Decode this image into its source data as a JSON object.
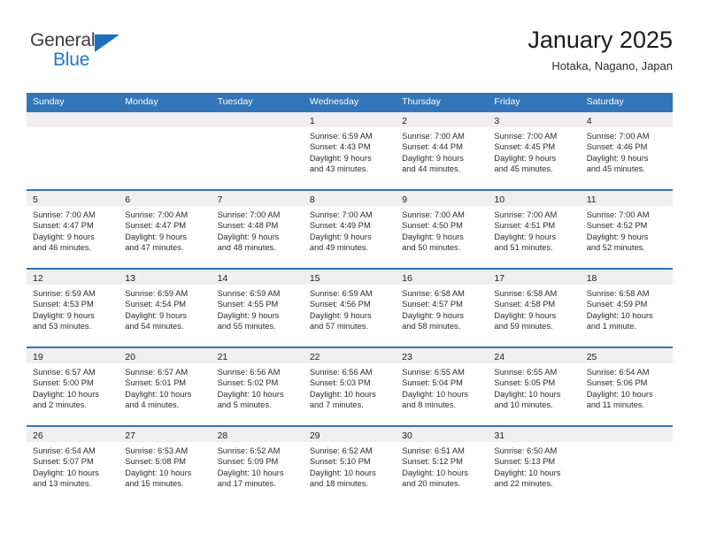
{
  "brand": {
    "name_top": "General",
    "name_bottom": "Blue",
    "accent_color": "#2079c8",
    "triangle_color": "#1f6fc0",
    "top_text_color": "#3c3c3c"
  },
  "header": {
    "title": "January 2025",
    "subtitle": "Hotaka, Nagano, Japan"
  },
  "theme": {
    "header_blue": "#3275b8",
    "band_gray": "#efefef",
    "text": "#222222"
  },
  "weekdays": [
    "Sunday",
    "Monday",
    "Tuesday",
    "Wednesday",
    "Thursday",
    "Friday",
    "Saturday"
  ],
  "weeks": [
    [
      {
        "day": "",
        "empty": true
      },
      {
        "day": "",
        "empty": true
      },
      {
        "day": "",
        "empty": true
      },
      {
        "day": "1",
        "sunrise": "Sunrise: 6:59 AM",
        "sunset": "Sunset: 4:43 PM",
        "daylight_1": "Daylight: 9 hours",
        "daylight_2": "and 43 minutes."
      },
      {
        "day": "2",
        "sunrise": "Sunrise: 7:00 AM",
        "sunset": "Sunset: 4:44 PM",
        "daylight_1": "Daylight: 9 hours",
        "daylight_2": "and 44 minutes."
      },
      {
        "day": "3",
        "sunrise": "Sunrise: 7:00 AM",
        "sunset": "Sunset: 4:45 PM",
        "daylight_1": "Daylight: 9 hours",
        "daylight_2": "and 45 minutes."
      },
      {
        "day": "4",
        "sunrise": "Sunrise: 7:00 AM",
        "sunset": "Sunset: 4:46 PM",
        "daylight_1": "Daylight: 9 hours",
        "daylight_2": "and 45 minutes."
      }
    ],
    [
      {
        "day": "5",
        "sunrise": "Sunrise: 7:00 AM",
        "sunset": "Sunset: 4:47 PM",
        "daylight_1": "Daylight: 9 hours",
        "daylight_2": "and 46 minutes."
      },
      {
        "day": "6",
        "sunrise": "Sunrise: 7:00 AM",
        "sunset": "Sunset: 4:47 PM",
        "daylight_1": "Daylight: 9 hours",
        "daylight_2": "and 47 minutes."
      },
      {
        "day": "7",
        "sunrise": "Sunrise: 7:00 AM",
        "sunset": "Sunset: 4:48 PM",
        "daylight_1": "Daylight: 9 hours",
        "daylight_2": "and 48 minutes."
      },
      {
        "day": "8",
        "sunrise": "Sunrise: 7:00 AM",
        "sunset": "Sunset: 4:49 PM",
        "daylight_1": "Daylight: 9 hours",
        "daylight_2": "and 49 minutes."
      },
      {
        "day": "9",
        "sunrise": "Sunrise: 7:00 AM",
        "sunset": "Sunset: 4:50 PM",
        "daylight_1": "Daylight: 9 hours",
        "daylight_2": "and 50 minutes."
      },
      {
        "day": "10",
        "sunrise": "Sunrise: 7:00 AM",
        "sunset": "Sunset: 4:51 PM",
        "daylight_1": "Daylight: 9 hours",
        "daylight_2": "and 51 minutes."
      },
      {
        "day": "11",
        "sunrise": "Sunrise: 7:00 AM",
        "sunset": "Sunset: 4:52 PM",
        "daylight_1": "Daylight: 9 hours",
        "daylight_2": "and 52 minutes."
      }
    ],
    [
      {
        "day": "12",
        "sunrise": "Sunrise: 6:59 AM",
        "sunset": "Sunset: 4:53 PM",
        "daylight_1": "Daylight: 9 hours",
        "daylight_2": "and 53 minutes."
      },
      {
        "day": "13",
        "sunrise": "Sunrise: 6:59 AM",
        "sunset": "Sunset: 4:54 PM",
        "daylight_1": "Daylight: 9 hours",
        "daylight_2": "and 54 minutes."
      },
      {
        "day": "14",
        "sunrise": "Sunrise: 6:59 AM",
        "sunset": "Sunset: 4:55 PM",
        "daylight_1": "Daylight: 9 hours",
        "daylight_2": "and 55 minutes."
      },
      {
        "day": "15",
        "sunrise": "Sunrise: 6:59 AM",
        "sunset": "Sunset: 4:56 PM",
        "daylight_1": "Daylight: 9 hours",
        "daylight_2": "and 57 minutes."
      },
      {
        "day": "16",
        "sunrise": "Sunrise: 6:58 AM",
        "sunset": "Sunset: 4:57 PM",
        "daylight_1": "Daylight: 9 hours",
        "daylight_2": "and 58 minutes."
      },
      {
        "day": "17",
        "sunrise": "Sunrise: 6:58 AM",
        "sunset": "Sunset: 4:58 PM",
        "daylight_1": "Daylight: 9 hours",
        "daylight_2": "and 59 minutes."
      },
      {
        "day": "18",
        "sunrise": "Sunrise: 6:58 AM",
        "sunset": "Sunset: 4:59 PM",
        "daylight_1": "Daylight: 10 hours",
        "daylight_2": "and 1 minute."
      }
    ],
    [
      {
        "day": "19",
        "sunrise": "Sunrise: 6:57 AM",
        "sunset": "Sunset: 5:00 PM",
        "daylight_1": "Daylight: 10 hours",
        "daylight_2": "and 2 minutes."
      },
      {
        "day": "20",
        "sunrise": "Sunrise: 6:57 AM",
        "sunset": "Sunset: 5:01 PM",
        "daylight_1": "Daylight: 10 hours",
        "daylight_2": "and 4 minutes."
      },
      {
        "day": "21",
        "sunrise": "Sunrise: 6:56 AM",
        "sunset": "Sunset: 5:02 PM",
        "daylight_1": "Daylight: 10 hours",
        "daylight_2": "and 5 minutes."
      },
      {
        "day": "22",
        "sunrise": "Sunrise: 6:56 AM",
        "sunset": "Sunset: 5:03 PM",
        "daylight_1": "Daylight: 10 hours",
        "daylight_2": "and 7 minutes."
      },
      {
        "day": "23",
        "sunrise": "Sunrise: 6:55 AM",
        "sunset": "Sunset: 5:04 PM",
        "daylight_1": "Daylight: 10 hours",
        "daylight_2": "and 8 minutes."
      },
      {
        "day": "24",
        "sunrise": "Sunrise: 6:55 AM",
        "sunset": "Sunset: 5:05 PM",
        "daylight_1": "Daylight: 10 hours",
        "daylight_2": "and 10 minutes."
      },
      {
        "day": "25",
        "sunrise": "Sunrise: 6:54 AM",
        "sunset": "Sunset: 5:06 PM",
        "daylight_1": "Daylight: 10 hours",
        "daylight_2": "and 11 minutes."
      }
    ],
    [
      {
        "day": "26",
        "sunrise": "Sunrise: 6:54 AM",
        "sunset": "Sunset: 5:07 PM",
        "daylight_1": "Daylight: 10 hours",
        "daylight_2": "and 13 minutes."
      },
      {
        "day": "27",
        "sunrise": "Sunrise: 6:53 AM",
        "sunset": "Sunset: 5:08 PM",
        "daylight_1": "Daylight: 10 hours",
        "daylight_2": "and 15 minutes."
      },
      {
        "day": "28",
        "sunrise": "Sunrise: 6:52 AM",
        "sunset": "Sunset: 5:09 PM",
        "daylight_1": "Daylight: 10 hours",
        "daylight_2": "and 17 minutes."
      },
      {
        "day": "29",
        "sunrise": "Sunrise: 6:52 AM",
        "sunset": "Sunset: 5:10 PM",
        "daylight_1": "Daylight: 10 hours",
        "daylight_2": "and 18 minutes."
      },
      {
        "day": "30",
        "sunrise": "Sunrise: 6:51 AM",
        "sunset": "Sunset: 5:12 PM",
        "daylight_1": "Daylight: 10 hours",
        "daylight_2": "and 20 minutes."
      },
      {
        "day": "31",
        "sunrise": "Sunrise: 6:50 AM",
        "sunset": "Sunset: 5:13 PM",
        "daylight_1": "Daylight: 10 hours",
        "daylight_2": "and 22 minutes."
      },
      {
        "day": "",
        "empty": true
      }
    ]
  ]
}
